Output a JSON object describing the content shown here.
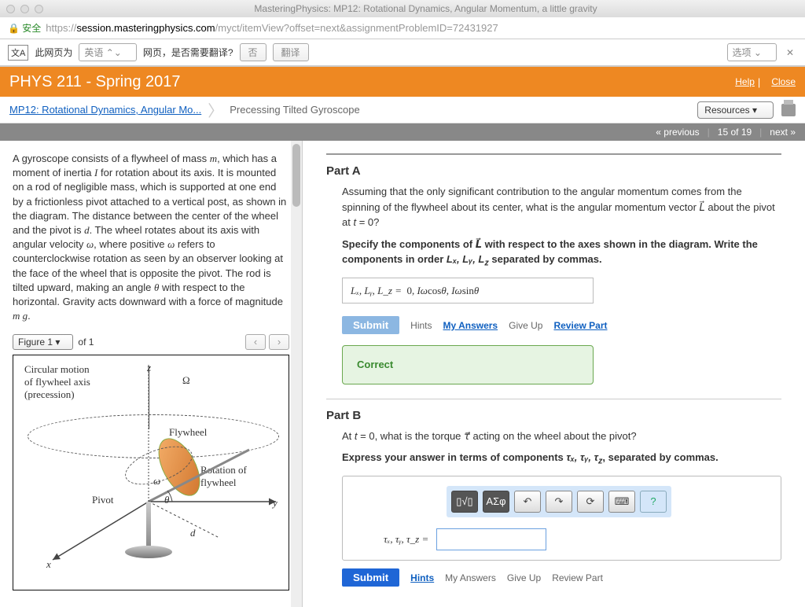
{
  "window": {
    "title": "MasteringPhysics: MP12: Rotational Dynamics, Angular Momentum, a little gravity",
    "lock_label": "安全",
    "url_https": "https://",
    "url_host": "session.masteringphysics.com",
    "url_path": "/myct/itemView?offset=next&assignmentProblemID=72431927"
  },
  "translate": {
    "prefix": "此网页为",
    "lang": "英语",
    "question": "网页，是否需要翻译?",
    "no": "否",
    "yes": "翻译",
    "options": "选项"
  },
  "course": {
    "title": "PHYS 211 - Spring 2017",
    "help": "Help",
    "close": "Close"
  },
  "breadcrumb": {
    "parent": "MP12: Rotational Dynamics, Angular Mo...",
    "current": "Precessing Tilted Gyroscope",
    "resources": "Resources"
  },
  "nav": {
    "prev": "« previous",
    "position": "15 of 19",
    "next": "next »"
  },
  "problem": {
    "text": "A gyroscope consists of a flywheel of mass m, which has a moment of inertia I for rotation about its axis. It is mounted on a rod of negligible mass, which is supported at one end by a frictionless pivot attached to a vertical post, as shown in the diagram. The distance between the center of the wheel and the pivot is d. The wheel rotates about its axis with angular velocity ω, where positive ω refers to counterclockwise rotation as seen by an observer looking at the face of the wheel that is opposite the pivot. The rod is tilted upward, making an angle θ with respect to the horizontal. Gravity acts downward with a force of magnitude m g."
  },
  "figure": {
    "selector": "Figure 1",
    "of": "of 1",
    "labels": {
      "precession": "Circular motion\nof flywheel axis\n(precession)",
      "z": "z",
      "omega_cap": "Ω",
      "flywheel": "Flywheel",
      "rotation": "Rotation of\nflywheel",
      "omega": "ω",
      "pivot": "Pivot",
      "theta": "θ",
      "d": "d",
      "x": "x",
      "y": "y"
    }
  },
  "partA": {
    "title": "Part A",
    "q1": "Assuming that the only significant contribution to the angular momentum comes from the spinning of the flywheel about its center, what is the angular momentum vector L⃗ about the pivot at t = 0?",
    "q2": "Specify the components of L⃗ with respect to the axes shown in the diagram. Write the components in order Lₓ, Lᵧ, L_z separated by commas.",
    "answer_lhs": "Lₓ, Lᵧ, L_z =",
    "answer_rhs": "0, Iωcosθ, Iωsinθ",
    "submit": "Submit",
    "hints": "Hints",
    "myanswers": "My Answers",
    "giveup": "Give Up",
    "review": "Review Part",
    "correct": "Correct"
  },
  "partB": {
    "title": "Part B",
    "q1": "At t = 0, what is the torque τ⃗ acting on the wheel about the pivot?",
    "q2": "Express your answer in terms of components τₓ, τᵧ, τ_z, separated by commas.",
    "lhs": "τₓ, τᵧ, τ_z =",
    "submit": "Submit",
    "hints": "Hints",
    "myanswers": "My Answers",
    "giveup": "Give Up",
    "review": "Review Part",
    "toolbar": {
      "frac": "▯√▯",
      "greek": "ΑΣφ",
      "undo": "↶",
      "redo": "↷",
      "reset": "⟳",
      "keyboard": "⌨",
      "help": "?"
    }
  }
}
